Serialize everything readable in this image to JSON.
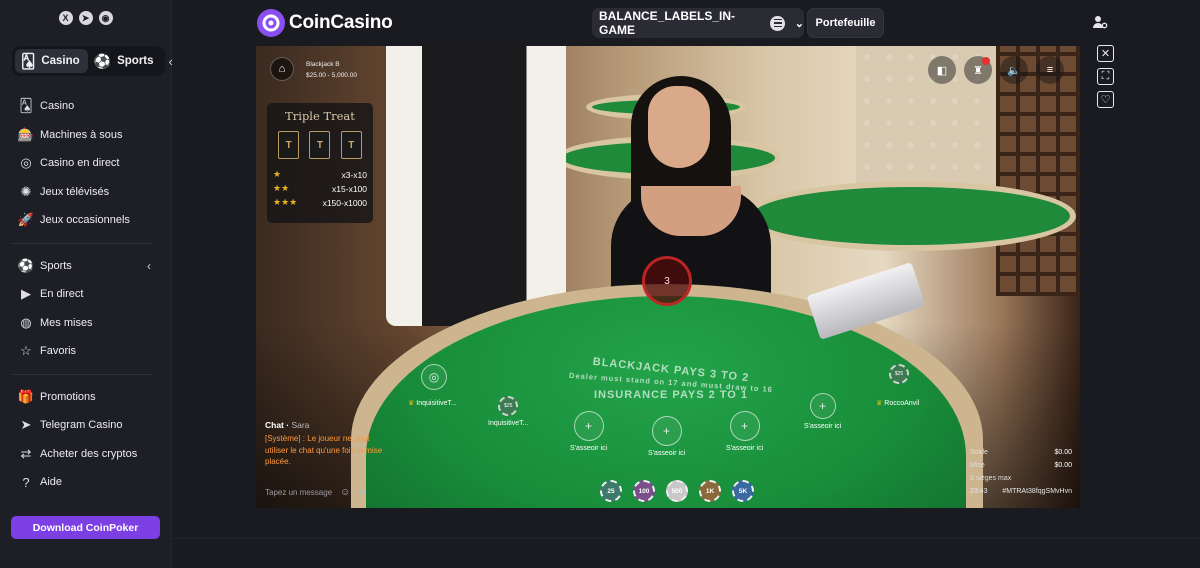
{
  "sidebar": {
    "socials": [
      {
        "icon": "x-icon",
        "glyph": "X"
      },
      {
        "icon": "telegram-icon",
        "glyph": "➤"
      },
      {
        "icon": "discord-icon",
        "glyph": "◉"
      }
    ],
    "toggle": {
      "casino": "Casino",
      "sports": "Sports"
    },
    "group1": [
      {
        "label": "Casino",
        "icon": "cards-icon",
        "glyph": "🂡"
      },
      {
        "label": "Machines à sous",
        "icon": "slot-machine-icon",
        "glyph": "🎰"
      },
      {
        "label": "Casino en direct",
        "icon": "live-casino-icon",
        "glyph": "◎"
      },
      {
        "label": "Jeux télévisés",
        "icon": "tv-games-icon",
        "glyph": "✺"
      },
      {
        "label": "Jeux occasionnels",
        "icon": "rocket-icon",
        "glyph": "🚀"
      }
    ],
    "group2": [
      {
        "label": "Sports",
        "icon": "sports-icon",
        "glyph": "⚽"
      },
      {
        "label": "En direct",
        "icon": "live-icon",
        "glyph": "▶"
      },
      {
        "label": "Mes mises",
        "icon": "my-bets-icon",
        "glyph": "◍"
      },
      {
        "label": "Favoris",
        "icon": "star-icon",
        "glyph": "☆"
      }
    ],
    "group3": [
      {
        "label": "Promotions",
        "icon": "gift-icon",
        "glyph": "🎁"
      },
      {
        "label": "Telegram Casino",
        "icon": "telegram-icon",
        "glyph": "➤"
      },
      {
        "label": "Acheter des cryptos",
        "icon": "crypto-icon",
        "glyph": "⇄"
      },
      {
        "label": "Aide",
        "icon": "help-icon",
        "glyph": "?"
      }
    ],
    "download_label": "Download CoinPoker"
  },
  "header": {
    "logo_text": "CoinCasino",
    "balance_label": "BALANCE_LABELS_IN-GAME",
    "wallet_label": "Portefeuille"
  },
  "game": {
    "table_name": "Blackjack B",
    "table_limits": "$25.00 - 5,000.00",
    "triple_treat": {
      "title": "Triple Treat",
      "rows": [
        {
          "stars": "★",
          "value": "x3-x10"
        },
        {
          "stars": "★★",
          "value": "x15-x100"
        },
        {
          "stars": "★★★",
          "value": "x150-x1000"
        }
      ]
    },
    "timer": "3",
    "felt": {
      "line1": "BLACKJACK PAYS 3 TO 2",
      "line2": "Dealer must stand on 17 and must draw to 16",
      "line3": "INSURANCE PAYS 2 TO 1"
    },
    "players": {
      "left_name": "InquisitiveT...",
      "left_chip_name": "InquisitiveT...",
      "right_name": "RoccoAnvil"
    },
    "sit_here": "S'asseoir ici",
    "chat": {
      "title": "Chat",
      "user": "Sara",
      "system_tag": "[Système] :",
      "message": "Le joueur ne peut utiliser le chat qu'une fois la mise placée.",
      "placeholder": "Tapez un message"
    },
    "chips": [
      "25",
      "100",
      "500",
      "1K",
      "5K"
    ],
    "chip_colors": [
      "#3d7a6a",
      "#7a4f8a",
      "#c8c8c8",
      "#8a6a3a",
      "#3a6aa0"
    ],
    "stats": {
      "balance_label": "Solde",
      "balance_value": "$0.00",
      "bet_label": "Mise",
      "bet_value": "$0.00",
      "seats": "3 sièges max",
      "time": "23:43",
      "round_id": "#MTRAt38fqgSMvHvn"
    }
  }
}
